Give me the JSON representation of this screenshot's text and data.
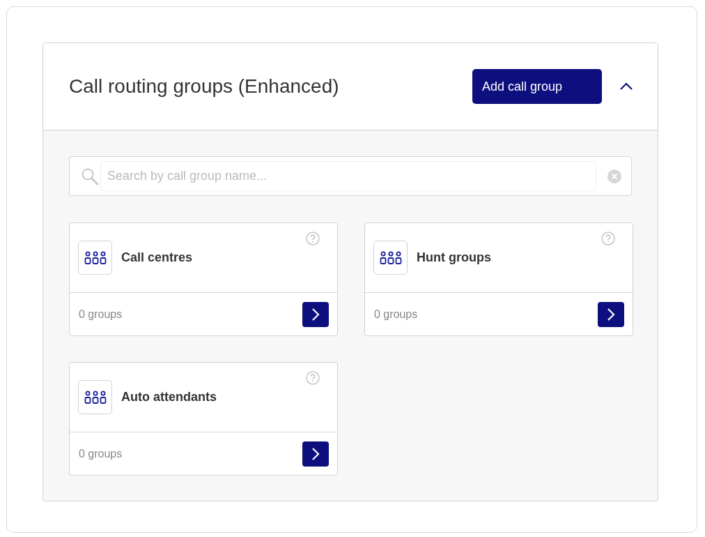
{
  "panel": {
    "title": "Call routing groups (Enhanced)",
    "add_button": "Add call group",
    "expanded": true
  },
  "search": {
    "placeholder": "Search by call group name..."
  },
  "groups": [
    {
      "name": "Call centres",
      "count": "0 groups"
    },
    {
      "name": "Hunt groups",
      "count": "0 groups"
    },
    {
      "name": "Auto attendants",
      "count": "0 groups"
    }
  ]
}
